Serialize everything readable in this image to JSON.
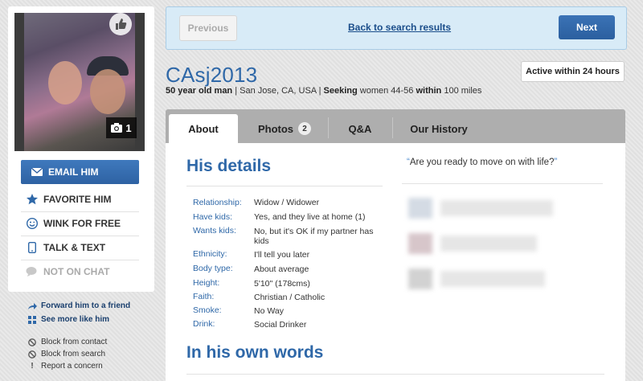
{
  "profile": {
    "username": "CAsj2013",
    "active_status": "Active within 24 hours",
    "summary": {
      "age_gender": "50 year old man",
      "location": "San Jose, CA, USA",
      "seeking_label": "Seeking",
      "seeking_value": "women 44-56",
      "within_label": "within",
      "within_value": "100 miles"
    },
    "photo_count": "1",
    "quote": "Are you ready to move on with life?"
  },
  "nav": {
    "previous_label": "Previous",
    "back_label": "Back to search results",
    "next_label": "Next"
  },
  "actions": {
    "email": "EMAIL HIM",
    "favorite": "FAVORITE HIM",
    "wink": "WINK FOR FREE",
    "talk": "TALK & TEXT",
    "chat": "NOT ON CHAT"
  },
  "links": {
    "forward": "Forward him to a friend",
    "more_like": "See more like him",
    "block_contact": "Block from contact",
    "block_search": "Block from search",
    "report": "Report a concern"
  },
  "tabs": {
    "about": "About",
    "photos": "Photos",
    "photos_count": "2",
    "qa": "Q&A",
    "history": "Our History"
  },
  "details": {
    "heading": "His details",
    "rows": [
      {
        "label": "Relationship:",
        "value": "Widow / Widower"
      },
      {
        "label": "Have kids:",
        "value": "Yes, and they live at home (1)"
      },
      {
        "label": "Wants kids:",
        "value": "No, but it's OK if my partner has kids"
      },
      {
        "label": "Ethnicity:",
        "value": "I'll tell you later"
      },
      {
        "label": "Body type:",
        "value": "About average"
      },
      {
        "label": "Height:",
        "value": "5'10\" (178cms)"
      },
      {
        "label": "Faith:",
        "value": "Christian / Catholic"
      },
      {
        "label": "Smoke:",
        "value": "No Way"
      },
      {
        "label": "Drink:",
        "value": "Social Drinker"
      }
    ]
  },
  "own_words_heading": "In his own words",
  "colors": {
    "brand_blue": "#2f68a8",
    "nav_bg": "#d8ebf7",
    "button_blue": "#2e62a3"
  }
}
